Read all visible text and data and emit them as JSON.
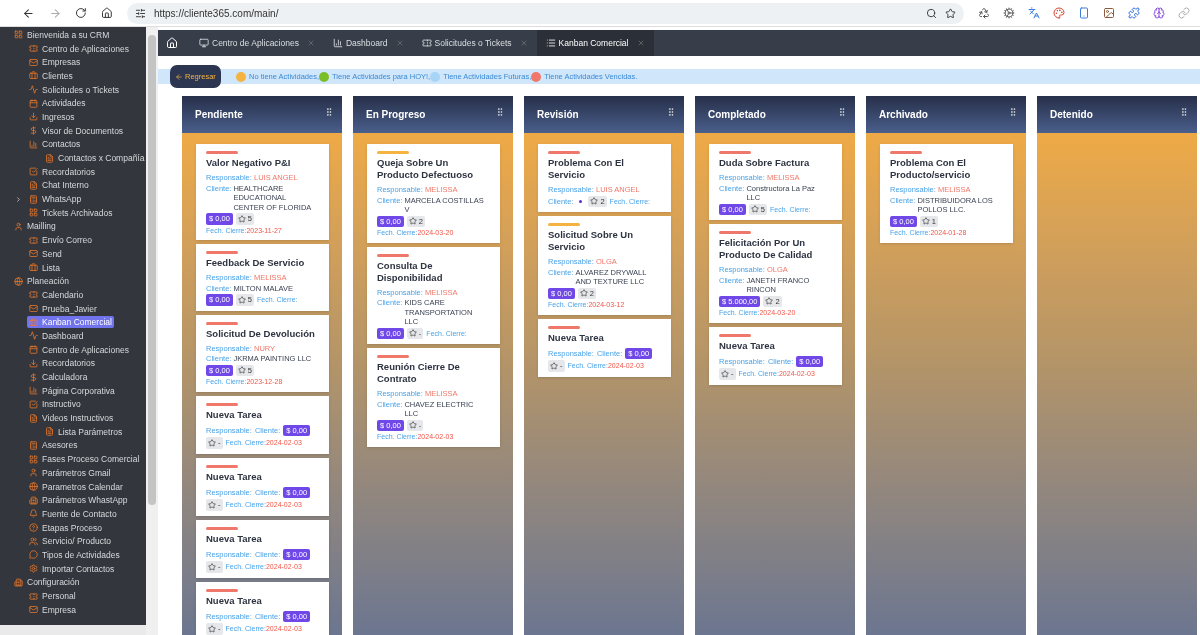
{
  "browser": {
    "url": "https://cliente365.com/main/"
  },
  "sidebar": {
    "items": [
      {
        "label": "Bienvenida a su CRM",
        "selected": false,
        "children": [
          {
            "label": "Centro de Aplicaciones",
            "selected": false
          },
          {
            "label": "Empresas",
            "selected": false
          },
          {
            "label": "Clientes",
            "selected": false
          },
          {
            "label": "Solicitudes o Tickets",
            "selected": false
          },
          {
            "label": "Actividades",
            "selected": false
          },
          {
            "label": "Ingresos",
            "selected": false
          },
          {
            "label": "Visor de Documentos",
            "selected": false
          },
          {
            "label": "Contactos",
            "selected": false,
            "children": [
              {
                "label": "Contactos x Compañía",
                "selected": false
              }
            ]
          },
          {
            "label": "Recordatorios",
            "selected": false
          },
          {
            "label": "Chat Interno",
            "selected": false
          },
          {
            "label": "WhatsApp",
            "selected": false,
            "expanded": false
          },
          {
            "label": "Tickets Archivados",
            "selected": false
          }
        ]
      },
      {
        "label": "Mailling",
        "selected": false,
        "children": [
          {
            "label": "Envío Correo",
            "selected": false
          },
          {
            "label": "Send",
            "selected": false
          },
          {
            "label": "Lista",
            "selected": false
          }
        ]
      },
      {
        "label": "Planeación",
        "selected": false,
        "children": [
          {
            "label": "Calendario",
            "selected": false
          },
          {
            "label": "Prueba_Javier",
            "selected": false
          },
          {
            "label": "Kanban Comercial",
            "selected": true
          },
          {
            "label": "Dashboard",
            "selected": false
          },
          {
            "label": "Centro de Aplicaciones",
            "selected": false
          },
          {
            "label": "Recordatorios",
            "selected": false
          },
          {
            "label": "Calculadora",
            "selected": false
          },
          {
            "label": "Página Corporativa",
            "selected": false
          },
          {
            "label": "Instructivo",
            "selected": false
          },
          {
            "label": "Videos Instructivos",
            "selected": false,
            "children": [
              {
                "label": "Lista Parámetros",
                "selected": false
              }
            ]
          },
          {
            "label": "Asesores",
            "selected": false
          },
          {
            "label": "Fases Proceso Comercial",
            "selected": false
          },
          {
            "label": "Parámetros Gmail",
            "selected": false
          },
          {
            "label": "Parametros Calendar",
            "selected": false
          },
          {
            "label": "Parámetros WhastApp",
            "selected": false
          },
          {
            "label": "Fuente de Contacto",
            "selected": false
          },
          {
            "label": "Etapas Proceso",
            "selected": false
          },
          {
            "label": "Servicio/ Producto",
            "selected": false
          },
          {
            "label": "Tipos de Actividades",
            "selected": false
          },
          {
            "label": "Importar Contactos",
            "selected": false
          }
        ]
      },
      {
        "label": "Configuración",
        "selected": false,
        "children": [
          {
            "label": "Personal",
            "selected": false
          },
          {
            "label": "Empresa",
            "selected": false
          }
        ]
      }
    ]
  },
  "tabs": [
    {
      "label": "Centro de Aplicaciones",
      "selected": false
    },
    {
      "label": "Dashboard",
      "selected": false
    },
    {
      "label": "Solicitudes o Tickets",
      "selected": false
    },
    {
      "label": "Kanban Comercial",
      "selected": true
    }
  ],
  "back_button": "Regresar",
  "legend": {
    "items": [
      {
        "color": "#f5b342",
        "text": "No tiene Actividades,"
      },
      {
        "color": "#7cbd2a",
        "text": "Tiene Actividades para HOY!,"
      },
      {
        "color": "#a8d4f5",
        "text": "Tiene Actividades Futuras,"
      },
      {
        "color": "#f0786a",
        "text": "Tiene Actividades Vencidas."
      }
    ]
  },
  "columns": [
    {
      "title": "Pendiente",
      "cards": [
        {
          "title": "Valor Negativo P&I",
          "color": "#f0786a",
          "responsable_label": "Responsable:",
          "responsable": "LUIS ANGEL",
          "cliente_label": "Cliente:",
          "cliente": "HEALTHCARE EDUCATIONAL CENTER OF FLORIDA",
          "amount": "$ 0,00",
          "rating": "5",
          "date_label": "Fech. Cierre:",
          "date": "2023-11-27"
        },
        {
          "title": "Feedback De Servicio",
          "color": "#f0786a",
          "responsable_label": "Responsable:",
          "responsable": "MELISSA",
          "cliente_label": "Cliente:",
          "cliente": "MILTON MALAVE",
          "amount": "$ 0,00",
          "rating": "5",
          "date_label": "Fech. Cierre:"
        },
        {
          "title": "Solicitud De Devolución",
          "color": "#f0786a",
          "responsable_label": "Responsable:",
          "responsable": "NURY",
          "cliente_label": "Cliente:",
          "cliente": "JKRMA PAINTING LLC",
          "amount": "$ 0,00",
          "rating": "5",
          "date_label": "Fech. Cierre:",
          "date": "2023-12-28"
        },
        {
          "title": "Nueva Tarea",
          "color": "#f0786a",
          "responsable_label": "Responsable:",
          "cliente_label": "Cliente:",
          "amount": "$ 0,00",
          "rating": "-",
          "date_label": "Fech. Cierre:",
          "date": "2024-02-03"
        },
        {
          "title": "Nueva Tarea",
          "color": "#f0786a",
          "responsable_label": "Responsable:",
          "cliente_label": "Cliente:",
          "amount": "$ 0,00",
          "rating": "-",
          "date_label": "Fech. Cierre:",
          "date": "2024-02-03"
        },
        {
          "title": "Nueva Tarea",
          "color": "#f0786a",
          "responsable_label": "Responsable:",
          "cliente_label": "Cliente:",
          "amount": "$ 0,00",
          "rating": "-",
          "date_label": "Fech. Cierre:",
          "date": "2024-02-03"
        },
        {
          "title": "Nueva Tarea",
          "color": "#f0786a",
          "responsable_label": "Responsable:",
          "cliente_label": "Cliente:",
          "amount": "$ 0,00",
          "rating": "-",
          "date_label": "Fech. Cierre:",
          "date": "2024-02-03"
        }
      ]
    },
    {
      "title": "En Progreso",
      "cards": [
        {
          "title": "Queja Sobre Un Producto Defectuoso",
          "color": "#f5b342",
          "responsable_label": "Responsable:",
          "responsable": "MELISSA",
          "cliente_label": "Cliente:",
          "cliente": "MARCELA COSTILLAS V",
          "amount": "$ 0,00",
          "rating": "2",
          "date_label": "Fech. Cierre:",
          "date": "2024-03-20"
        },
        {
          "title": "Consulta De Disponibilidad",
          "color": "#f0786a",
          "responsable_label": "Responsable:",
          "responsable": "MELISSA",
          "cliente_label": "Cliente:",
          "cliente": "KIDS CARE TRANSPORTATION LLC",
          "amount": "$ 0,00",
          "rating": "-",
          "date_label": "Fech. Cierre:"
        },
        {
          "title": "Reunión Cierre De Contrato",
          "color": "#f0786a",
          "responsable_label": "Responsable:",
          "responsable": "MELISSA",
          "cliente_label": "Cliente:",
          "cliente": "CHAVEZ ELECTRIC LLC",
          "amount": "$ 0,00",
          "rating": "-",
          "date_label": "Fech. Cierre:",
          "date": "2024-02-03"
        }
      ]
    },
    {
      "title": "Revisión",
      "cards": [
        {
          "title": "Problema Con El Servicio",
          "color": "#f0786a",
          "responsable_label": "Responsable:",
          "responsable": "LUIS ANGEL",
          "cliente_label": "Cliente:",
          "rating": "2",
          "date_label": "Fech. Cierre:"
        },
        {
          "title": "Solicitud Sobre Un Servicio",
          "color": "#f5b342",
          "responsable_label": "Responsable:",
          "responsable": "OLGA",
          "cliente_label": "Cliente:",
          "cliente": "ALVAREZ DRYWALL AND TEXTURE LLC",
          "amount": "$ 0,00",
          "rating": "2",
          "date_label": "Fech. Cierre:",
          "date": "2024-03-12"
        },
        {
          "title": "Nueva Tarea",
          "color": "#f0786a",
          "responsable_label": "Responsable:",
          "cliente_label": "Cliente:",
          "amount": "$ 0,00",
          "rating": "-",
          "date_label": "Fech. Cierre:",
          "date": "2024-02-03"
        }
      ]
    },
    {
      "title": "Completado",
      "cards": [
        {
          "title": "Duda Sobre Factura",
          "color": "#f0786a",
          "responsable_label": "Responsable:",
          "responsable": "MELISSA",
          "cliente_label": "Cliente:",
          "cliente": "Constructora La Paz LLC",
          "amount": "$ 0,00",
          "rating": "5",
          "date_label": "Fech. Cierre:"
        },
        {
          "title": "Felicitación Por Un Producto De Calidad",
          "color": "#f0786a",
          "responsable_label": "Responsable:",
          "responsable": "OLGA",
          "cliente_label": "Cliente:",
          "cliente": "JANETH FRANCO RINCON",
          "amount": "$ 5.000,00",
          "rating": "2",
          "date_label": "Fech. Cierre:",
          "date": "2024-03-20"
        },
        {
          "title": "Nueva Tarea",
          "color": "#f0786a",
          "responsable_label": "Responsable:",
          "cliente_label": "Cliente:",
          "amount": "$ 0,00",
          "rating": "-",
          "date_label": "Fech. Cierre:",
          "date": "2024-02-03"
        }
      ]
    },
    {
      "title": "Archivado",
      "cards": [
        {
          "title": "Problema Con El Producto/servicio",
          "color": "#f0786a",
          "responsable_label": "Responsable:",
          "responsable": "MELISSA",
          "cliente_label": "Cliente:",
          "cliente": "DISTRIBUIDORA LOS POLLOS LLC.",
          "amount": "$ 0,00",
          "rating": "1",
          "date_label": "Fech. Cierre:",
          "date": "2024-01-28"
        }
      ]
    },
    {
      "title": "Detenido"
    }
  ]
}
